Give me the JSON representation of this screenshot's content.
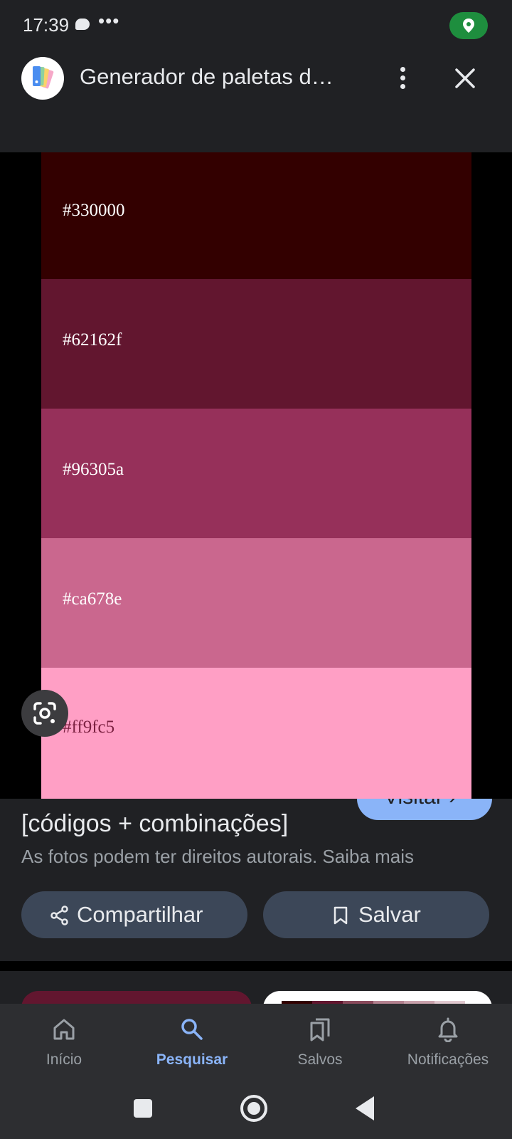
{
  "status_bar": {
    "time": "17:39",
    "chat_icon": "chat-bubble-icon",
    "more_glyph": "•••",
    "location_icon": "location-pin-icon"
  },
  "header": {
    "app_icon": "palette-app-icon",
    "title": "Generador de paletas d…"
  },
  "palette": {
    "swatches": [
      {
        "label": "#330000",
        "color": "#330000",
        "text_color": "#ffffff"
      },
      {
        "label": "#62162f",
        "color": "#62162f",
        "text_color": "#ffffff"
      },
      {
        "label": "#96305a",
        "color": "#96305a",
        "text_color": "#ffffff"
      },
      {
        "label": "#ca678e",
        "color": "#ca678e",
        "text_color": "#ffffff"
      },
      {
        "label": "#ff9fc5",
        "color": "#ff9fc5",
        "text_color": "#7a2040"
      }
    ]
  },
  "result": {
    "visit_label": "Visitar ›",
    "title": "[códigos + combinações]",
    "copyright": "As fotos podem ter direitos autorais. Saiba mais",
    "share_label": "Compartilhar",
    "save_label": "Salvar"
  },
  "bottom_nav": {
    "items": [
      {
        "label": "Início",
        "icon": "home-icon",
        "active": false
      },
      {
        "label": "Pesquisar",
        "icon": "search-icon",
        "active": true
      },
      {
        "label": "Salvos",
        "icon": "bookmarks-icon",
        "active": false
      },
      {
        "label": "Notificações",
        "icon": "bell-icon",
        "active": false
      }
    ]
  },
  "colors": {
    "background": "#202124",
    "accent": "#8ab4f8",
    "button_bg": "#3c4758",
    "location_green": "#1e8e3e"
  }
}
